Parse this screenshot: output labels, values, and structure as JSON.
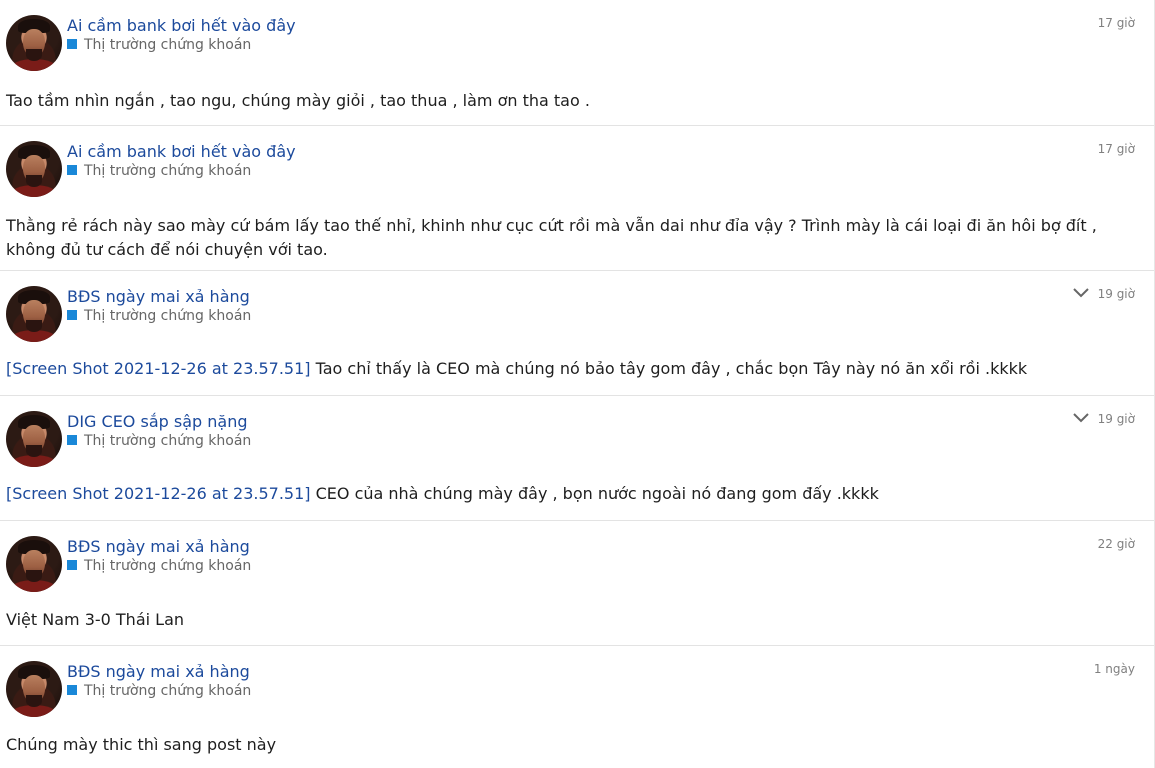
{
  "avatar_alt": "user-avatar",
  "category_color": "#1a88d8",
  "posts": [
    {
      "title": "Ai cầm bank bơi hết vào đây",
      "category": "Thị trường chứng khoán",
      "time": "17 giờ",
      "attachment": "",
      "body": "Tao tầm nhìn ngắn , tao ngu, chúng mày giỏi , tao thua , làm ơn tha tao ."
    },
    {
      "title": "Ai cầm bank bơi hết vào đây",
      "category": "Thị trường chứng khoán",
      "time": "17 giờ",
      "attachment": "",
      "body": "Thằng rẻ rách này sao mày cứ bám lấy tao thế nhỉ, khinh như cục cứt rồi mà vẫn dai như đỉa vậy ? Trình mày là cái loại đi ăn hôi bợ đít , không đủ tư cách để nói chuyện với tao."
    },
    {
      "title": "BĐS ngày mai xả hàng",
      "category": "Thị trường chứng khoán",
      "time": "19 giờ",
      "attachment": "[Screen Shot 2021-12-26 at 23.57.51]",
      "body": "Tao chỉ thấy là CEO mà chúng nó bảo tây gom đây , chắc bọn Tây này nó ăn xổi rồi .kkkk"
    },
    {
      "title": "DIG CEO sắp sập nặng",
      "category": "Thị trường chứng khoán",
      "time": "19 giờ",
      "attachment": "[Screen Shot 2021-12-26 at 23.57.51]",
      "body": "CEO của nhà chúng mày đây , bọn nước ngoài nó đang gom đấy .kkkk"
    },
    {
      "title": "BĐS ngày mai xả hàng",
      "category": "Thị trường chứng khoán",
      "time": "22 giờ",
      "attachment": "",
      "body": "Việt Nam 3-0 Thái Lan"
    },
    {
      "title": "BĐS ngày mai xả hàng",
      "category": "Thị trường chứng khoán",
      "time": "1 ngày",
      "attachment": "",
      "body": "Chúng mày thic thì sang post này"
    }
  ]
}
